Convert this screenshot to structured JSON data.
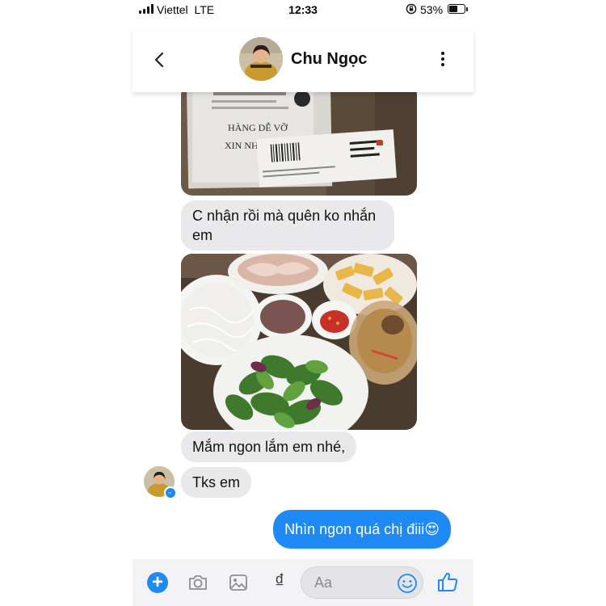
{
  "status_bar": {
    "carrier": "Viettel",
    "network": "LTE",
    "time": "12:33",
    "battery_percent": "53%",
    "battery_level": 0.53,
    "icons": [
      "signal-icon",
      "orientation-lock-icon",
      "battery-icon"
    ]
  },
  "header": {
    "contact_name": "Chu Ngọc",
    "icons": [
      "back-chevron-icon",
      "more-options-icon"
    ]
  },
  "messages": {
    "incoming": [
      {
        "text": "C nhận rồi mà quên ko nhắn em"
      },
      {
        "text": "Mắm ngon lắm em nhé,"
      },
      {
        "text": "Tks em"
      }
    ],
    "outgoing": [
      {
        "text": "Nhìn ngon quá chị điii😍"
      }
    ],
    "package_label": {
      "line1": "HÀNG DỄ VỠ",
      "line2": "XIN NHẸ"
    }
  },
  "composer": {
    "placeholder": "Aa",
    "currency_symbol": "₫",
    "plus_symbol": "+",
    "icons": [
      "plus-icon",
      "camera-icon",
      "photo-icon",
      "payment-icon",
      "emoji-icon",
      "like-icon"
    ]
  },
  "colors": {
    "accent": "#1f8af5",
    "incoming_bubble": "#e9e9eb",
    "outgoing_text": "#ffffff"
  }
}
